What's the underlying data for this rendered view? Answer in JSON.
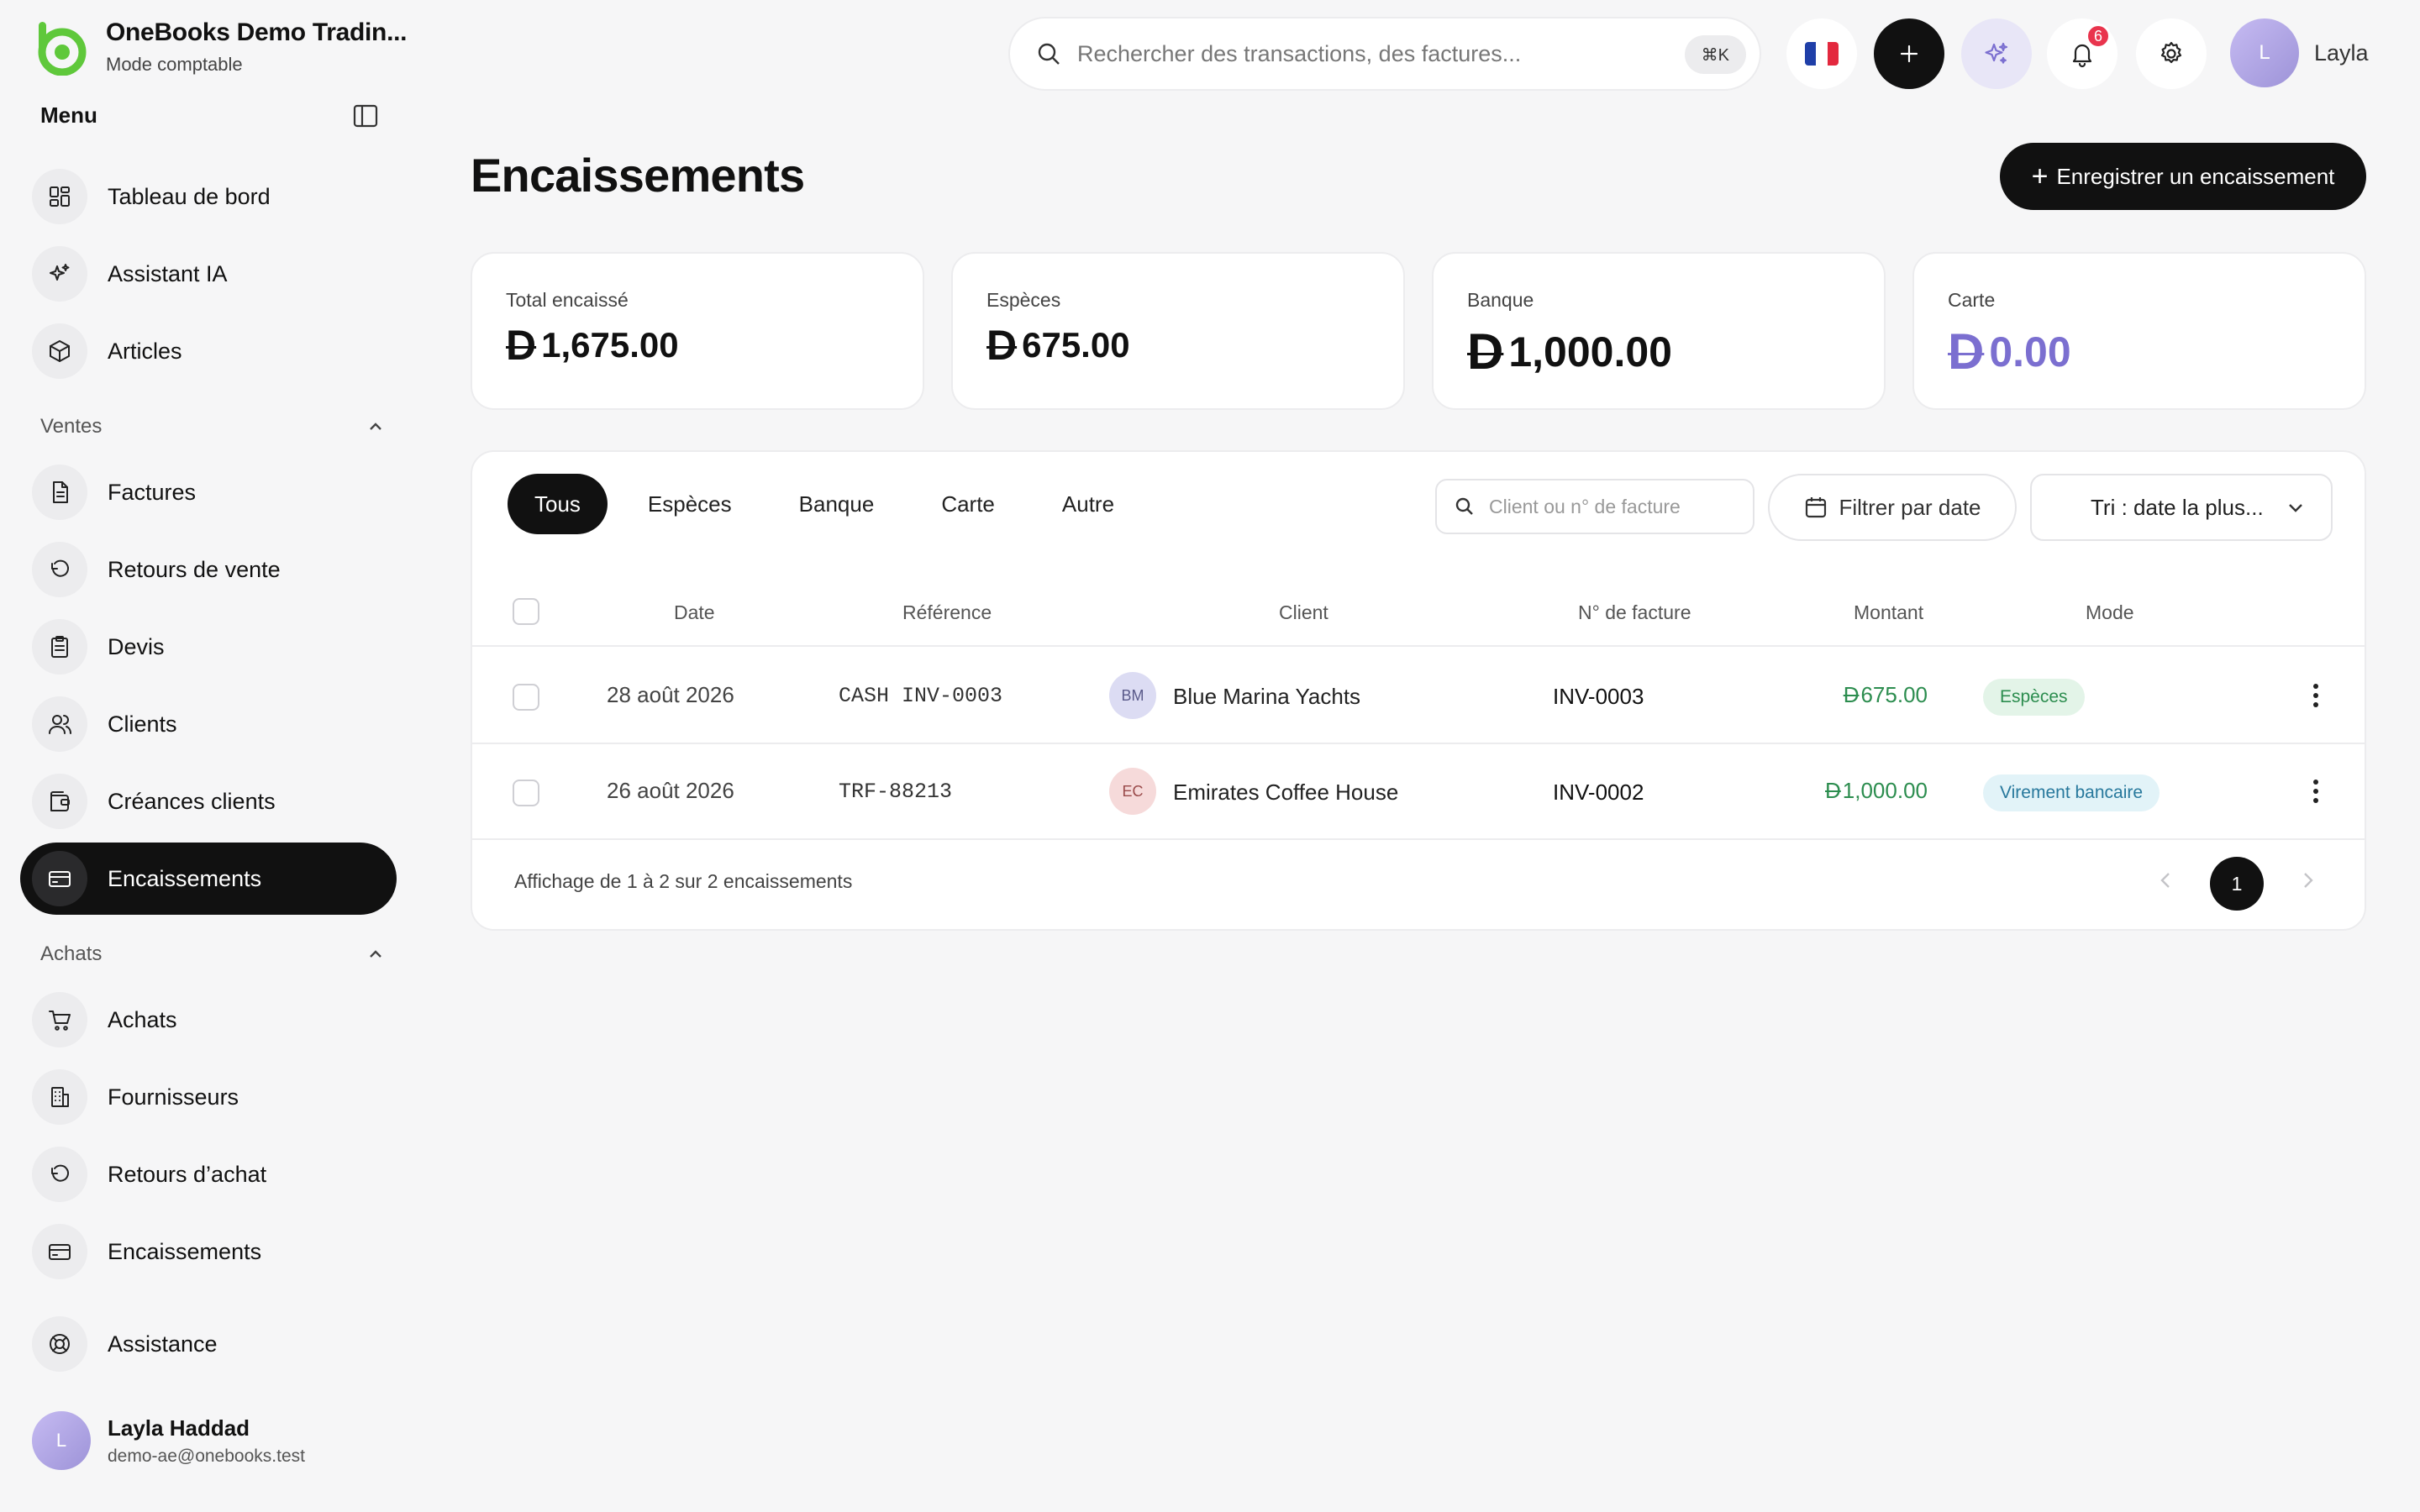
{
  "brand": {
    "name": "OneBooks Demo Tradin...",
    "subtitle": "Mode comptable"
  },
  "sidebar": {
    "menu_title": "Menu",
    "top_items": [
      {
        "label": "Tableau de bord",
        "icon": "dashboard-icon"
      },
      {
        "label": "Assistant IA",
        "icon": "sparkles-icon"
      },
      {
        "label": "Articles",
        "icon": "box-icon"
      }
    ],
    "sections": [
      {
        "title": "Ventes",
        "items": [
          {
            "label": "Factures",
            "icon": "invoice-icon"
          },
          {
            "label": "Retours de vente",
            "icon": "undo-icon"
          },
          {
            "label": "Devis",
            "icon": "clipboard-icon"
          },
          {
            "label": "Clients",
            "icon": "users-icon"
          },
          {
            "label": "Créances clients",
            "icon": "wallet-icon"
          },
          {
            "label": "Encaissements",
            "icon": "card-icon",
            "active": true
          }
        ]
      },
      {
        "title": "Achats",
        "items": [
          {
            "label": "Achats",
            "icon": "cart-icon"
          },
          {
            "label": "Fournisseurs",
            "icon": "building-icon"
          },
          {
            "label": "Retours d’achat",
            "icon": "undo-icon"
          },
          {
            "label": "Encaissements",
            "icon": "card-icon"
          }
        ]
      }
    ],
    "support": {
      "label": "Assistance",
      "icon": "lifebuoy-icon"
    },
    "user": {
      "initial": "L",
      "name": "Layla Haddad",
      "email": "demo-ae@onebooks.test"
    }
  },
  "topbar": {
    "search_placeholder": "Rechercher des transactions, des factures...",
    "shortcut": "⌘K",
    "notifications_count": "6",
    "user_initial": "L",
    "user_name": "Layla"
  },
  "page": {
    "title": "Encaissements",
    "primary_action": "Enregistrer un encaissement"
  },
  "currency_symbol": "D",
  "stats": [
    {
      "label": "Total encaissé",
      "value": "1,675.00"
    },
    {
      "label": "Espèces",
      "value": "675.00"
    },
    {
      "label": "Banque",
      "value": "1,000.00"
    },
    {
      "label": "Carte",
      "value": "0.00"
    }
  ],
  "filters": {
    "tabs": [
      "Tous",
      "Espèces",
      "Banque",
      "Carte",
      "Autre"
    ],
    "active_tab": "Tous",
    "search_placeholder": "Client ou n° de facture",
    "date_filter": "Filtrer par date",
    "sort": "Tri : date la plus..."
  },
  "table": {
    "columns": [
      "Date",
      "Référence",
      "Client",
      "N° de facture",
      "Montant",
      "Mode"
    ],
    "rows": [
      {
        "date": "28 août 2026",
        "reference": "CASH INV-0003",
        "client_initials": "BM",
        "client": "Blue Marina Yachts",
        "invoice": "INV-0003",
        "amount": "675.00",
        "mode": "Espèces",
        "mode_color": "#2c8d4f",
        "mode_bg": "#e3f4e8",
        "avatar_bg": "#dcdcf3",
        "avatar_color": "#5a5a8a"
      },
      {
        "date": "26 août 2026",
        "reference": "TRF-88213",
        "client_initials": "EC",
        "client": "Emirates Coffee House",
        "invoice": "INV-0002",
        "amount": "1,000.00",
        "mode": "Virement bancaire",
        "mode_color": "#27789c",
        "mode_bg": "#e2f3f8",
        "avatar_bg": "#f6dada",
        "avatar_color": "#9a4a4a"
      }
    ],
    "footer": "Affichage de 1 à 2 sur 2 encaissements",
    "current_page": "1"
  },
  "colors": {
    "accent": "#111111",
    "brand_green": "#5fc83b",
    "amount_green": "#2c8d4f",
    "carte_purple": "#7b6fd0"
  }
}
